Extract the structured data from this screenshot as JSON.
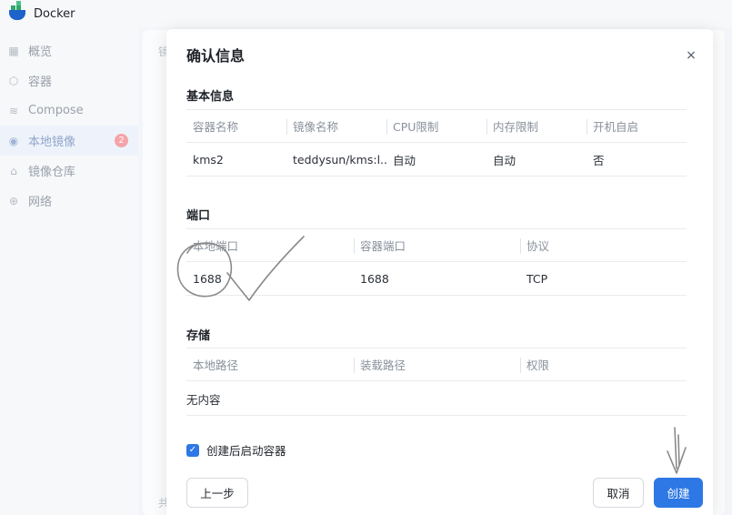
{
  "app": {
    "title": "Docker"
  },
  "sidebar": {
    "items": [
      {
        "label": "概览",
        "icon": "grid-icon"
      },
      {
        "label": "容器",
        "icon": "cube-icon"
      },
      {
        "label": "Compose",
        "icon": "layers-icon"
      },
      {
        "label": "本地镜像",
        "icon": "eye-icon",
        "badge": "2",
        "active": true
      },
      {
        "label": "镜像仓库",
        "icon": "home-icon"
      },
      {
        "label": "网络",
        "icon": "globe-icon"
      }
    ]
  },
  "background": {
    "top_fragment": "镜",
    "bottom_fragment": "共"
  },
  "modal": {
    "title": "确认信息",
    "close_symbol": "×",
    "basic": {
      "title": "基本信息",
      "columns": [
        "容器名称",
        "镜像名称",
        "CPU限制",
        "内存限制",
        "开机自启"
      ],
      "rows": [
        [
          "kms2",
          "teddysun/kms:l...",
          "自动",
          "自动",
          "否"
        ]
      ]
    },
    "ports": {
      "title": "端口",
      "columns": [
        "本地端口",
        "容器端口",
        "协议"
      ],
      "rows": [
        [
          "1688",
          "1688",
          "TCP"
        ]
      ]
    },
    "storage": {
      "title": "存储",
      "columns": [
        "本地路径",
        "装载路径",
        "权限"
      ],
      "empty_text": "无内容"
    },
    "start_after_create": {
      "label": "创建后启动容器",
      "checked": true
    },
    "buttons": {
      "prev": "上一步",
      "cancel": "取消",
      "create": "创建"
    }
  },
  "colors": {
    "primary": "#2d78e4",
    "badge": "#f5a3a8",
    "annotation_ink": "#8a8a8a"
  }
}
